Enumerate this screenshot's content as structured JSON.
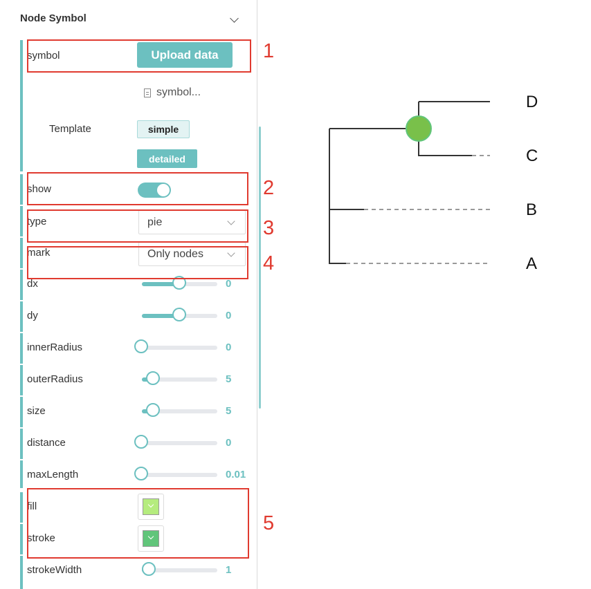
{
  "section": {
    "title": "Node Symbol"
  },
  "symbol": {
    "label": "symbol",
    "upload_label": "Upload data",
    "file_name": "symbol..."
  },
  "template": {
    "label": "Template",
    "options": [
      "simple",
      "detailed"
    ]
  },
  "show": {
    "label": "show",
    "value": true
  },
  "type": {
    "label": "type",
    "value": "pie"
  },
  "mark": {
    "label": "mark",
    "value": "Only nodes"
  },
  "sliders": [
    {
      "label": "dx",
      "value": "0",
      "level": 0.5
    },
    {
      "label": "dy",
      "value": "0",
      "level": 0.5
    },
    {
      "label": "innerRadius",
      "value": "0",
      "level": 0.0
    },
    {
      "label": "outerRadius",
      "value": "5",
      "level": 0.16
    },
    {
      "label": "size",
      "value": "5",
      "level": 0.16
    },
    {
      "label": "distance",
      "value": "0",
      "level": 0.0
    },
    {
      "label": "maxLength",
      "value": "0.01",
      "level": 0.0
    }
  ],
  "fill": {
    "label": "fill",
    "color": "#b5ec7e"
  },
  "stroke": {
    "label": "stroke",
    "color": "#61c57a"
  },
  "strokeWidth": {
    "label": "strokeWidth",
    "value": "1",
    "level": 0.1
  },
  "annotations": [
    "1",
    "2",
    "3",
    "4",
    "5"
  ],
  "tree": {
    "leaves": [
      "D",
      "C",
      "B",
      "A"
    ],
    "node_fill": "#79c04a",
    "node_stroke": "#61c57a"
  }
}
